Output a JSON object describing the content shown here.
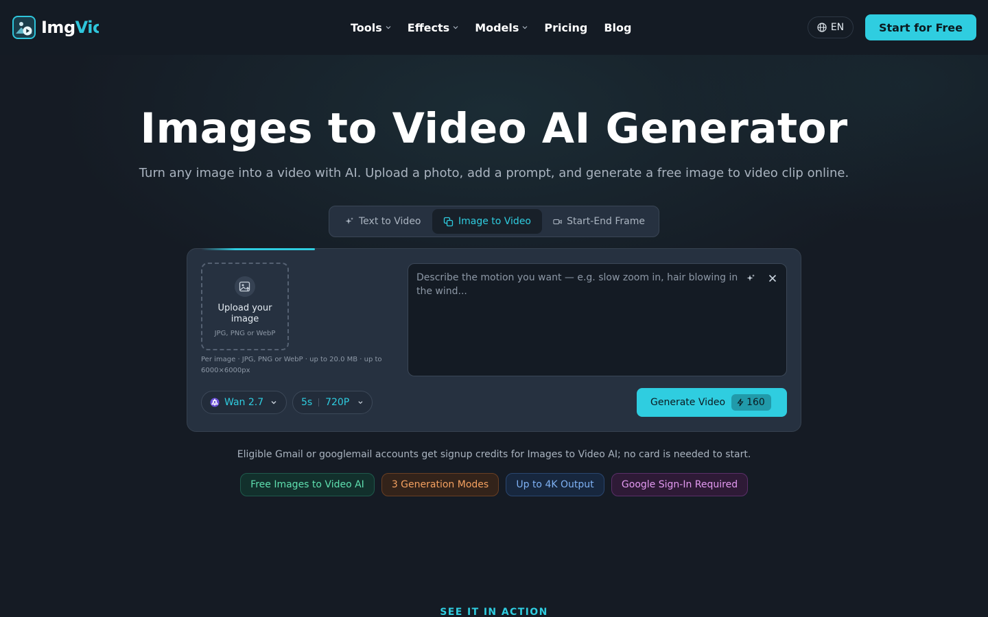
{
  "header": {
    "logo_text_a": "Img",
    "logo_text_b": "Vic",
    "nav": [
      {
        "label": "Tools",
        "has_dropdown": true
      },
      {
        "label": "Effects",
        "has_dropdown": true
      },
      {
        "label": "Models",
        "has_dropdown": true
      },
      {
        "label": "Pricing",
        "has_dropdown": false
      },
      {
        "label": "Blog",
        "has_dropdown": false
      }
    ],
    "language": "EN",
    "cta": "Start for Free"
  },
  "hero": {
    "title": "Images to Video AI Generator",
    "subtitle": "Turn any image into a video with AI. Upload a photo, add a prompt, and generate a free image to video clip online."
  },
  "mode_tabs": [
    {
      "label": "Text to Video",
      "icon": "sparkle-icon",
      "active": false
    },
    {
      "label": "Image to Video",
      "icon": "images-icon",
      "active": true
    },
    {
      "label": "Start-End Frame",
      "icon": "video-camera-icon",
      "active": false
    }
  ],
  "generator": {
    "upload_title": "Upload your image",
    "upload_hint": "JPG, PNG or WebP",
    "upload_note": "Per image · JPG, PNG or WebP · up to 20.0 MB · up to 6000×6000px",
    "prompt_placeholder": "Describe the motion you want — e.g. slow zoom in, hair blowing in the wind...",
    "prompt_value": "",
    "model": "Wan 2.7",
    "duration": "5s",
    "resolution": "720P",
    "generate_label": "Generate Video",
    "credits": "160"
  },
  "eligible_text": "Eligible Gmail or googlemail accounts get signup credits for Images to Video AI; no card is needed to start.",
  "badges": [
    {
      "label": "Free Images to Video AI",
      "color": "#5fe0b0"
    },
    {
      "label": "3 Generation Modes",
      "color": "#f5a160"
    },
    {
      "label": "Up to 4K Output",
      "color": "#7fb2f5"
    },
    {
      "label": "Google Sign-In Required",
      "color": "#e49af2"
    }
  ],
  "section_label": "SEE IT IN ACTION",
  "colors": {
    "accent": "#2fcde0",
    "background": "#151b24",
    "card": "#263140"
  }
}
